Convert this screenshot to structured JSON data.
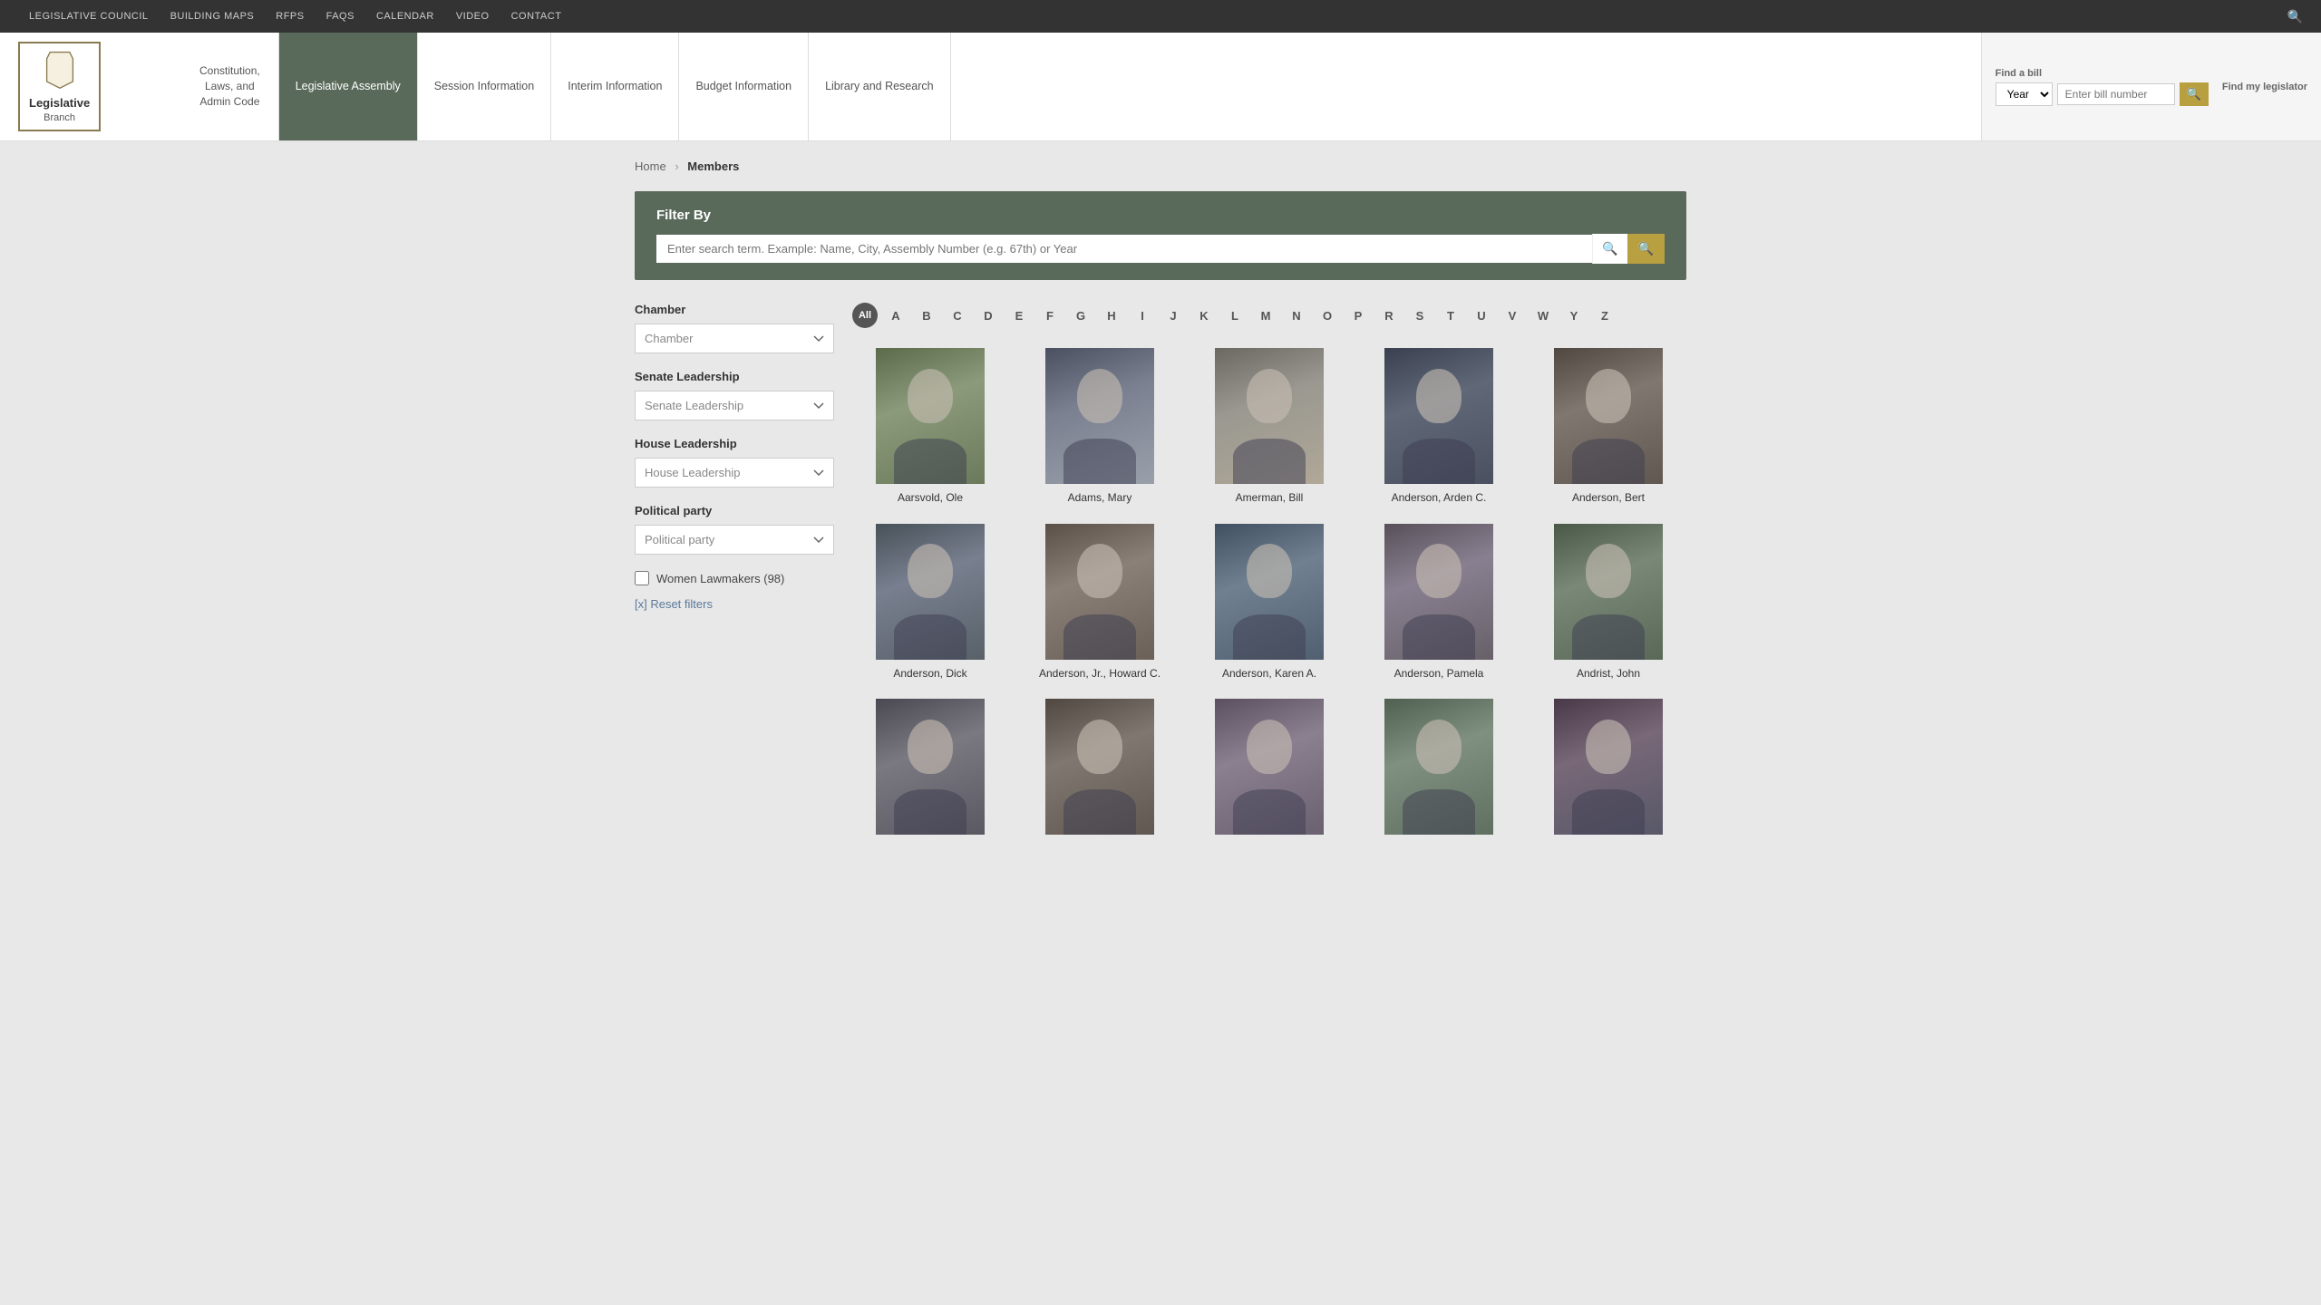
{
  "topnav": {
    "items": [
      {
        "label": "Legislative Council",
        "id": "legislative-council"
      },
      {
        "label": "Building Maps",
        "id": "building-maps"
      },
      {
        "label": "RFPs",
        "id": "rfps"
      },
      {
        "label": "FAQs",
        "id": "faqs"
      },
      {
        "label": "Calendar",
        "id": "calendar"
      },
      {
        "label": "Video",
        "id": "video"
      },
      {
        "label": "Contact",
        "id": "contact"
      }
    ]
  },
  "header": {
    "logo": {
      "line1": "Legislative",
      "line2": "Branch"
    },
    "const_nav": "Constitution,\nLaws, and\nAdmin Code",
    "nav_tabs": [
      {
        "label": "Legislative Assembly",
        "id": "legislative-assembly",
        "active": true
      },
      {
        "label": "Session Information",
        "id": "session-info",
        "active": false
      },
      {
        "label": "Interim Information",
        "id": "interim-info",
        "active": false
      },
      {
        "label": "Budget Information",
        "id": "budget-info",
        "active": false
      },
      {
        "label": "Library and Research",
        "id": "library-research",
        "active": false
      }
    ],
    "bill_finder": {
      "find_bill_label": "Find a bill",
      "find_legislator_label": "Find my legislator",
      "year_placeholder": "Year",
      "bill_placeholder": "Enter bill number"
    }
  },
  "breadcrumb": {
    "home": "Home",
    "current": "Members"
  },
  "filter_bar": {
    "label": "Filter By",
    "search_placeholder": "Enter search term. Example: Name, City, Assembly Number (e.g. 67th) or Year"
  },
  "sidebar": {
    "chamber_label": "Chamber",
    "chamber_placeholder": "Chamber",
    "senate_leadership_label": "Senate Leadership",
    "senate_leadership_placeholder": "Senate Leadership",
    "house_leadership_label": "House Leadership",
    "house_leadership_placeholder": "House Leadership",
    "political_party_label": "Political party",
    "political_party_placeholder": "Political party",
    "women_lawmakers": "Women Lawmakers (98)",
    "reset_filters": "[x] Reset filters"
  },
  "alpha_nav": {
    "all_label": "All",
    "letters": [
      "A",
      "B",
      "C",
      "D",
      "E",
      "F",
      "G",
      "H",
      "I",
      "J",
      "K",
      "L",
      "M",
      "N",
      "O",
      "P",
      "R",
      "S",
      "T",
      "U",
      "V",
      "W",
      "Y",
      "Z"
    ]
  },
  "members": [
    {
      "name": "Aarsvold, Ole",
      "photo_class": "photo-1"
    },
    {
      "name": "Adams, Mary",
      "photo_class": "photo-2"
    },
    {
      "name": "Amerman, Bill",
      "photo_class": "photo-3"
    },
    {
      "name": "Anderson, Arden C.",
      "photo_class": "photo-4"
    },
    {
      "name": "Anderson, Bert",
      "photo_class": "photo-5"
    },
    {
      "name": "Anderson, Dick",
      "photo_class": "photo-6"
    },
    {
      "name": "Anderson, Jr., Howard C.",
      "photo_class": "photo-7"
    },
    {
      "name": "Anderson, Karen A.",
      "photo_class": "photo-8"
    },
    {
      "name": "Anderson, Pamela",
      "photo_class": "photo-9"
    },
    {
      "name": "Andrist, John",
      "photo_class": "photo-10"
    },
    {
      "name": "",
      "photo_class": "photo-11"
    },
    {
      "name": "",
      "photo_class": "photo-12"
    },
    {
      "name": "",
      "photo_class": "photo-13"
    },
    {
      "name": "",
      "photo_class": "photo-14"
    },
    {
      "name": "",
      "photo_class": "photo-15"
    }
  ]
}
